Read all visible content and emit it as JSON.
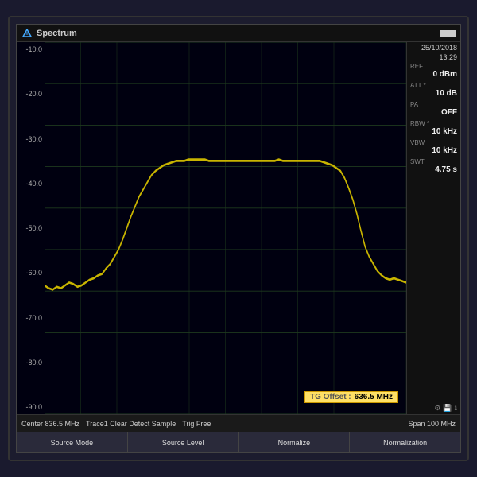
{
  "title": "Spectrum",
  "datetime": {
    "date": "25/10/2018",
    "time": "13:29"
  },
  "battery_full": true,
  "right_panel": {
    "ref_label": "REF",
    "ref_value": "0 dBm",
    "att_label": "ATT *",
    "att_value": "10 dB",
    "pa_label": "PA",
    "pa_value": "OFF",
    "rbw_label": "RBW *",
    "rbw_value": "10 kHz",
    "vbw_label": "VBW",
    "vbw_value": "10 kHz",
    "swt_label": "SWT",
    "swt_value": "4.75 s"
  },
  "y_axis": {
    "labels": [
      "-10.0",
      "-20.0",
      "-30.0",
      "-40.0",
      "-50.0",
      "-60.0",
      "-70.0",
      "-80.0",
      "-90.0"
    ]
  },
  "tg_offset": {
    "label": "TG Offset :",
    "value": "636.5 MHz"
  },
  "status_bar": {
    "center": "Center  836.5 MHz",
    "trace": "Trace1  Clear  Detect  Sample",
    "trig": "Trig  Free",
    "span": "Span  100 MHz"
  },
  "bottom_buttons": [
    "Source Mode",
    "Source Level",
    "Normalize",
    "Normalization"
  ]
}
